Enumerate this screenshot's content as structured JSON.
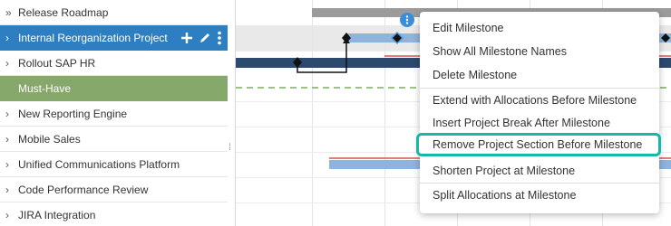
{
  "projects": [
    {
      "label": "Release Roadmap",
      "chevron": "»"
    },
    {
      "label": "Internal Reorganization Project",
      "chevron": "›"
    },
    {
      "label": "Rollout SAP HR",
      "chevron": "›"
    },
    {
      "label": "Must-Have",
      "chevron": ""
    },
    {
      "label": "New Reporting Engine",
      "chevron": "›"
    },
    {
      "label": "Mobile Sales",
      "chevron": "›"
    },
    {
      "label": "Unified Communications Platform",
      "chevron": "›"
    },
    {
      "label": "Code Performance Review",
      "chevron": "›"
    },
    {
      "label": "JIRA Integration",
      "chevron": "›"
    }
  ],
  "row_actions": [
    "plus-icon",
    "pencil-icon",
    "kebab-icon"
  ],
  "menu": {
    "items": [
      "Edit Milestone",
      "Show All Milestone Names",
      "Delete Milestone",
      "Extend with Allocations Before Milestone",
      "Insert Project Break After Milestone",
      "Remove Project Section Before Milestone",
      "Shorten Project at Milestone",
      "Split Allocations at Milestone"
    ],
    "highlighted": "Remove Project Section Before Milestone"
  },
  "colors": {
    "selected_row": "#2d7fc1",
    "group_row": "#86a86a",
    "highlight_border": "#16b6a8",
    "bar_dark": "#2c4a6e",
    "bar_light": "#8eb3dd",
    "bar_gray": "#9b9b9b",
    "red_line": "#d9534f",
    "dashed_line": "#7cae5a"
  }
}
